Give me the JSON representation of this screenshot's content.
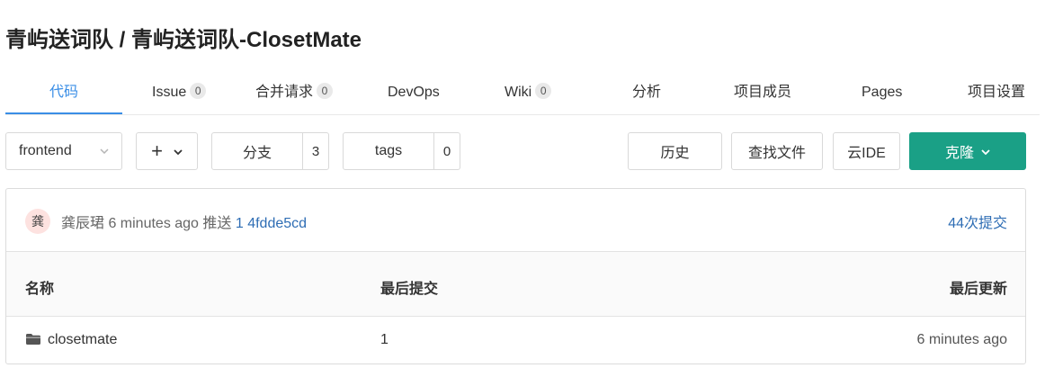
{
  "project": {
    "title": "青屿送词队 / 青屿送词队-ClosetMate"
  },
  "tabs": [
    {
      "label": "代码",
      "count": null,
      "active": true
    },
    {
      "label": "Issue",
      "count": "0"
    },
    {
      "label": "合并请求",
      "count": "0"
    },
    {
      "label": "DevOps",
      "count": null
    },
    {
      "label": "Wiki",
      "count": "0"
    },
    {
      "label": "分析",
      "count": null
    },
    {
      "label": "项目成员",
      "count": null
    },
    {
      "label": "Pages",
      "count": null
    },
    {
      "label": "项目设置",
      "count": null
    }
  ],
  "toolbar": {
    "branch_selected": "frontend",
    "add_symbol": "+",
    "branches_label": "分支",
    "branches_count": "3",
    "tags_label": "tags",
    "tags_count": "0",
    "history_label": "历史",
    "find_file_label": "查找文件",
    "cloud_ide_label": "云IDE",
    "clone_label": "克隆"
  },
  "commit": {
    "avatar_char": "龚",
    "author_time_action": "龚辰珺 6 minutes ago 推送 ",
    "sha": "1 4fdde5cd",
    "total_commits": "44次提交"
  },
  "file_table": {
    "headers": {
      "name": "名称",
      "last_commit": "最后提交",
      "last_update": "最后更新"
    },
    "rows": [
      {
        "name": "closetmate",
        "type": "folder",
        "last_commit": "1",
        "last_update": "6 minutes ago"
      }
    ]
  },
  "colors": {
    "accent": "#3a8ee6",
    "clone_button": "#1aa086",
    "link": "#2e6db4"
  }
}
